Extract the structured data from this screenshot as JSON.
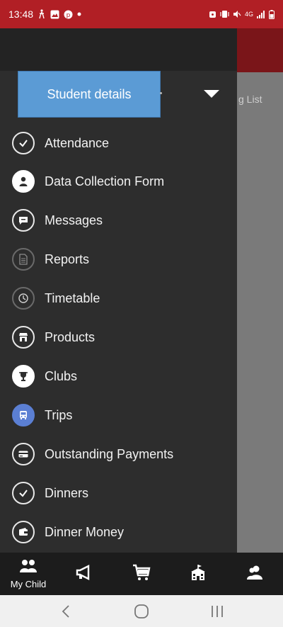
{
  "status_bar": {
    "time": "13:48",
    "network": "4G",
    "background_color": "#b11f25"
  },
  "background_screen": {
    "partial_text": "g List"
  },
  "drawer": {
    "student_selector_label": "Student details",
    "student_selector_color": "#5b9bd5",
    "menu_items": [
      {
        "label": "Attendance",
        "icon": "check-icon"
      },
      {
        "label": "Data Collection Form",
        "icon": "person-icon"
      },
      {
        "label": "Messages",
        "icon": "chat-icon"
      },
      {
        "label": "Reports",
        "icon": "document-icon"
      },
      {
        "label": "Timetable",
        "icon": "clock-icon"
      },
      {
        "label": "Products",
        "icon": "shop-icon"
      },
      {
        "label": "Clubs",
        "icon": "trophy-icon"
      },
      {
        "label": "Trips",
        "icon": "bus-icon"
      },
      {
        "label": "Outstanding Payments",
        "icon": "card-icon"
      },
      {
        "label": "Dinners",
        "icon": "check-icon"
      },
      {
        "label": "Dinner Money",
        "icon": "wallet-icon"
      }
    ]
  },
  "bottom_nav": {
    "items": [
      {
        "label": "My Child",
        "icon": "children-icon"
      },
      {
        "label": "",
        "icon": "megaphone-icon"
      },
      {
        "label": "",
        "icon": "cart-icon"
      },
      {
        "label": "",
        "icon": "school-icon"
      },
      {
        "label": "",
        "icon": "contacts-icon"
      }
    ]
  },
  "system_nav": {
    "buttons": [
      "back-icon",
      "home-icon",
      "recents-icon"
    ]
  }
}
